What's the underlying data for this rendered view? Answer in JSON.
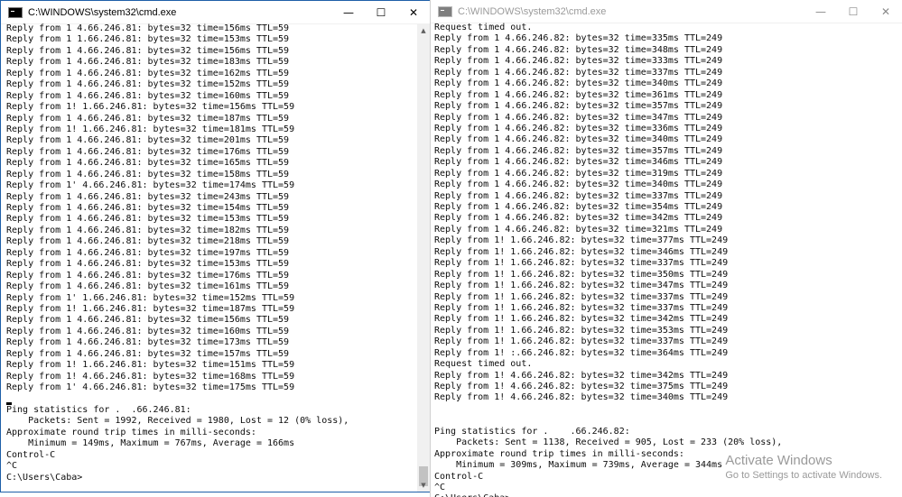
{
  "left_window": {
    "title": "C:\\WINDOWS\\system32\\cmd.exe",
    "controls": [
      "—",
      "☐",
      "✕"
    ],
    "lines": [
      "Reply from 1 4.66.246.81: bytes=32 time=156ms TTL=59",
      "Reply from 1 1.66.246.81: bytes=32 time=153ms TTL=59",
      "Reply from 1 4.66.246.81: bytes=32 time=156ms TTL=59",
      "Reply from 1 4.66.246.81: bytes=32 time=183ms TTL=59",
      "Reply from 1 4.66.246.81: bytes=32 time=162ms TTL=59",
      "Reply from 1 4.66.246.81: bytes=32 time=152ms TTL=59",
      "Reply from 1 4.66.246.81: bytes=32 time=160ms TTL=59",
      "Reply from 1! 1.66.246.81: bytes=32 time=156ms TTL=59",
      "Reply from 1 4.66.246.81: bytes=32 time=187ms TTL=59",
      "Reply from 1! 1.66.246.81: bytes=32 time=181ms TTL=59",
      "Reply from 1 4.66.246.81: bytes=32 time=201ms TTL=59",
      "Reply from 1 4.66.246.81: bytes=32 time=176ms TTL=59",
      "Reply from 1 4.66.246.81: bytes=32 time=165ms TTL=59",
      "Reply from 1 4.66.246.81: bytes=32 time=158ms TTL=59",
      "Reply from 1' 4.66.246.81: bytes=32 time=174ms TTL=59",
      "Reply from 1 4.66.246.81: bytes=32 time=243ms TTL=59",
      "Reply from 1 4.66.246.81: bytes=32 time=154ms TTL=59",
      "Reply from 1 4.66.246.81: bytes=32 time=153ms TTL=59",
      "Reply from 1 4.66.246.81: bytes=32 time=182ms TTL=59",
      "Reply from 1 4.66.246.81: bytes=32 time=218ms TTL=59",
      "Reply from 1 4.66.246.81: bytes=32 time=197ms TTL=59",
      "Reply from 1 4.66.246.81: bytes=32 time=153ms TTL=59",
      "Reply from 1 4.66.246.81: bytes=32 time=176ms TTL=59",
      "Reply from 1 4.66.246.81: bytes=32 time=161ms TTL=59",
      "Reply from 1' 1.66.246.81: bytes=32 time=152ms TTL=59",
      "Reply from 1! 1.66.246.81: bytes=32 time=187ms TTL=59",
      "Reply from 1 4.66.246.81: bytes=32 time=156ms TTL=59",
      "Reply from 1 4.66.246.81: bytes=32 time=160ms TTL=59",
      "Reply from 1 4.66.246.81: bytes=32 time=173ms TTL=59",
      "Reply from 1 4.66.246.81: bytes=32 time=157ms TTL=59",
      "Reply from 1! 1.66.246.81: bytes=32 time=151ms TTL=59",
      "Reply from 1! 4.66.246.81: bytes=32 time=168ms TTL=59",
      "Reply from 1' 4.66.246.81: bytes=32 time=175ms TTL=59"
    ],
    "stats": [
      "",
      "Ping statistics for .  .66.246.81:",
      "    Packets: Sent = 1992, Received = 1980, Lost = 12 (0% loss),",
      "Approximate round trip times in milli-seconds:",
      "    Minimum = 149ms, Maximum = 767ms, Average = 166ms",
      "Control-C",
      "^C",
      "C:\\Users\\Caba>"
    ]
  },
  "right_window": {
    "title": "C:\\WINDOWS\\system32\\cmd.exe",
    "controls": [
      "—",
      "☐",
      "✕"
    ],
    "lines": [
      "Request timed out.",
      "Reply from 1 4.66.246.82: bytes=32 time=335ms TTL=249",
      "Reply from 1 4.66.246.82: bytes=32 time=348ms TTL=249",
      "Reply from 1 4.66.246.82: bytes=32 time=333ms TTL=249",
      "Reply from 1 4.66.246.82: bytes=32 time=337ms TTL=249",
      "Reply from 1 4.66.246.82: bytes=32 time=340ms TTL=249",
      "Reply from 1 4.66.246.82: bytes=32 time=361ms TTL=249",
      "Reply from 1 4.66.246.82: bytes=32 time=357ms TTL=249",
      "Reply from 1 4.66.246.82: bytes=32 time=347ms TTL=249",
      "Reply from 1 4.66.246.82: bytes=32 time=336ms TTL=249",
      "Reply from 1 4.66.246.82: bytes=32 time=340ms TTL=249",
      "Reply from 1 4.66.246.82: bytes=32 time=357ms TTL=249",
      "Reply from 1 4.66.246.82: bytes=32 time=346ms TTL=249",
      "Reply from 1 4.66.246.82: bytes=32 time=319ms TTL=249",
      "Reply from 1 4.66.246.82: bytes=32 time=340ms TTL=249",
      "Reply from 1 4.66.246.82: bytes=32 time=337ms TTL=249",
      "Reply from 1 4.66.246.82: bytes=32 time=354ms TTL=249",
      "Reply from 1 4.66.246.82: bytes=32 time=342ms TTL=249",
      "Reply from 1 4.66.246.82: bytes=32 time=321ms TTL=249",
      "Reply from 1! 1.66.246.82: bytes=32 time=377ms TTL=249",
      "Reply from 1! 1.66.246.82: bytes=32 time=346ms TTL=249",
      "Reply from 1! 1.66.246.82: bytes=32 time=337ms TTL=249",
      "Reply from 1! 1.66.246.82: bytes=32 time=350ms TTL=249",
      "Reply from 1! 1.66.246.82: bytes=32 time=347ms TTL=249",
      "Reply from 1! 1.66.246.82: bytes=32 time=337ms TTL=249",
      "Reply from 1! 1.66.246.82: bytes=32 time=337ms TTL=249",
      "Reply from 1! 1.66.246.82: bytes=32 time=342ms TTL=249",
      "Reply from 1! 1.66.246.82: bytes=32 time=353ms TTL=249",
      "Reply from 1! 1.66.246.82: bytes=32 time=337ms TTL=249",
      "Reply from 1! :.66.246.82: bytes=32 time=364ms TTL=249",
      "Request timed out.",
      "Reply from 1! 4.66.246.82: bytes=32 time=342ms TTL=249",
      "Reply from 1! 4.66.246.82: bytes=32 time=375ms TTL=249",
      "Reply from 1! 4.66.246.82: bytes=32 time=340ms TTL=249"
    ],
    "stats": [
      "",
      "",
      "Ping statistics for .    .66.246.82:",
      "    Packets: Sent = 1138, Received = 905, Lost = 233 (20% loss),",
      "Approximate round trip times in milli-seconds:",
      "    Minimum = 309ms, Maximum = 739ms, Average = 344ms",
      "Control-C",
      "^C",
      "C:\\Users\\Caba>"
    ]
  },
  "watermark": {
    "line1": "Activate Windows",
    "line2": "Go to Settings to activate Windows."
  },
  "scroll_icons": {
    "up": "▲",
    "down": "▼"
  }
}
